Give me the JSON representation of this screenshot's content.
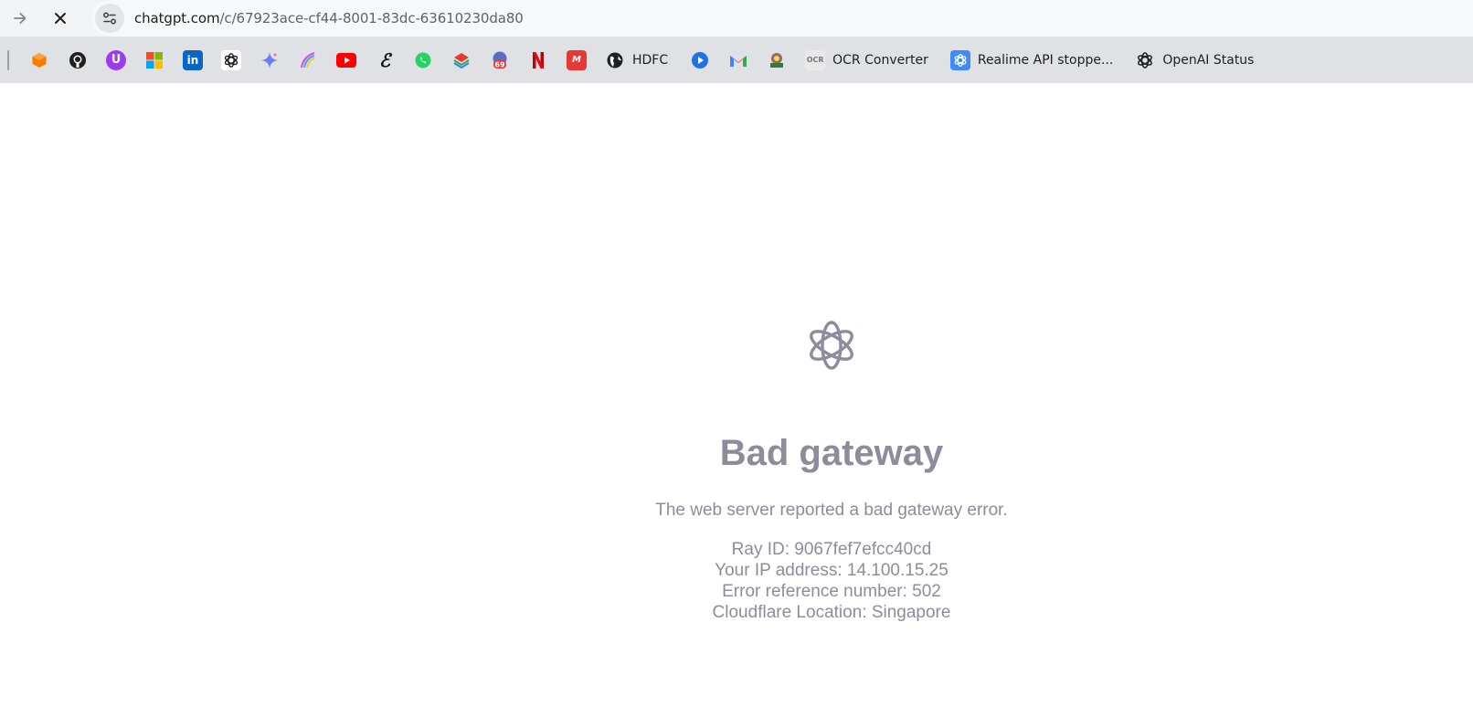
{
  "browser": {
    "url_host": "chatgpt.com",
    "url_path": "/c/67923ace-cf44-8001-83dc-63610230da80",
    "nav": {
      "forward_icon": "arrow-right-icon",
      "stop_icon": "close-icon",
      "site_info_icon": "tune-icon"
    }
  },
  "bookmarks": [
    {
      "icon": "box-icon",
      "color": "#f57c00",
      "label": ""
    },
    {
      "icon": "github-icon",
      "color": "#1f1f1f",
      "label": ""
    },
    {
      "icon": "u-icon",
      "color": "#9c3cf0",
      "label": ""
    },
    {
      "icon": "microsoft-icon",
      "color": "#f25022",
      "label": ""
    },
    {
      "icon": "linkedin-icon",
      "color": "#0a66c2",
      "label": ""
    },
    {
      "icon": "openai-icon",
      "color": "#1f1f1f",
      "label": ""
    },
    {
      "icon": "gemini-icon",
      "color": "#6b7cf6",
      "label": ""
    },
    {
      "icon": "rainbow-icon",
      "color": "#e040fb",
      "label": ""
    },
    {
      "icon": "youtube-icon",
      "color": "#ff0000",
      "label": ""
    },
    {
      "icon": "e-icon",
      "color": "#111111",
      "label": ""
    },
    {
      "icon": "whatsapp-icon",
      "color": "#25d366",
      "label": ""
    },
    {
      "icon": "layers-icon",
      "color": "#e53935",
      "label": ""
    },
    {
      "icon": "badge-69-icon",
      "color": "#5c6bc0",
      "label": ""
    },
    {
      "icon": "netflix-icon",
      "color": "#e50914",
      "label": ""
    },
    {
      "icon": "myntra-icon",
      "color": "#e53935",
      "label": ""
    },
    {
      "icon": "globe-icon",
      "color": "#202124",
      "label": "HDFC"
    },
    {
      "icon": "play-icon",
      "color": "#1a73e8",
      "label": ""
    },
    {
      "icon": "gmail-icon",
      "color": "#ea4335",
      "label": ""
    },
    {
      "icon": "emblem-icon",
      "color": "#2e7d32",
      "label": ""
    },
    {
      "icon": "ocr-icon",
      "color": "#e8e8e8",
      "label": "OCR Converter"
    },
    {
      "icon": "openai-blue-icon",
      "color": "#3d8bfd",
      "label": "Realime API stoppe..."
    },
    {
      "icon": "openai-icon",
      "color": "#1f1f1f",
      "label": "OpenAI Status"
    }
  ],
  "error": {
    "logo_icon": "openai-logo-icon",
    "title": "Bad gateway",
    "message": "The web server reported a bad gateway error.",
    "ray_id": "Ray ID: 9067fef7efcc40cd",
    "ip": "Your IP address: 14.100.15.25",
    "reference": "Error reference number: 502",
    "location": "Cloudflare Location: Singapore",
    "color": "#8c8c9c"
  }
}
